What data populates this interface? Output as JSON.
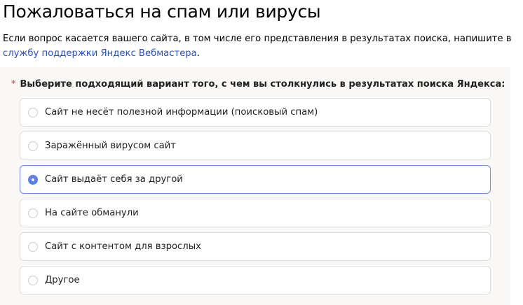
{
  "title": "Пожаловаться на спам или вирусы",
  "intro": {
    "text": "Если вопрос касается вашего сайта, в том числе его представления в результатах поиска, напишите в ",
    "link": "службу поддержки Яндекс Вебмастера",
    "end": "."
  },
  "question": {
    "required_mark": "*",
    "text": "Выберите подходящий вариант того, с чем вы столкнулись в результатах поиска Яндекса:"
  },
  "options": [
    {
      "label": "Сайт не несёт полезной информации (поисковый спам)",
      "selected": false
    },
    {
      "label": "Заражённый вирусом сайт",
      "selected": false
    },
    {
      "label": "Сайт выдаёт себя за другой",
      "selected": true
    },
    {
      "label": "На сайте обманули",
      "selected": false
    },
    {
      "label": "Сайт с контентом для взрослых",
      "selected": false
    },
    {
      "label": "Другое",
      "selected": false
    }
  ],
  "colors": {
    "accent": "#5b7ff5",
    "link": "#2a4fd0",
    "required": "#e8303d"
  }
}
